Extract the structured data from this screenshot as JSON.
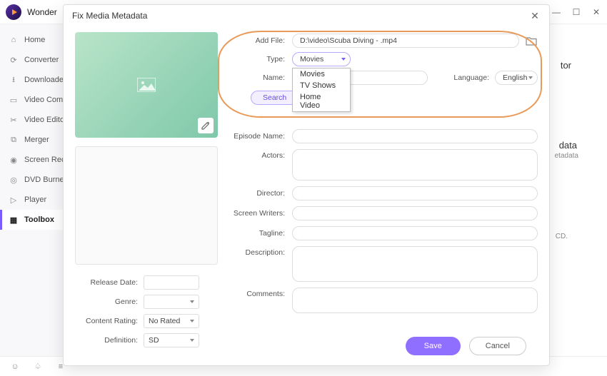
{
  "app": {
    "name": "Wonder"
  },
  "win": {
    "min": "—",
    "max": "☐",
    "close": "✕"
  },
  "sidebar": {
    "items": [
      {
        "icon": "home",
        "label": "Home"
      },
      {
        "icon": "convert",
        "label": "Converter"
      },
      {
        "icon": "download",
        "label": "Downloader"
      },
      {
        "icon": "compress",
        "label": "Video Compressor"
      },
      {
        "icon": "edit",
        "label": "Video Editor"
      },
      {
        "icon": "merge",
        "label": "Merger"
      },
      {
        "icon": "record",
        "label": "Screen Recorder"
      },
      {
        "icon": "dvd",
        "label": "DVD Burner"
      },
      {
        "icon": "player",
        "label": "Player"
      },
      {
        "icon": "toolbox",
        "label": "Toolbox"
      }
    ]
  },
  "bg": {
    "snip1": "tor",
    "snip2": "data",
    "snip3": "etadata",
    "snip4": "CD."
  },
  "modal": {
    "title": "Fix Media Metadata",
    "addfile_label": "Add File:",
    "addfile_value": "D:\\video\\Scuba Diving - .mp4",
    "type_label": "Type:",
    "type_value": "Movies",
    "type_options": [
      "Movies",
      "TV Shows",
      "Home Video"
    ],
    "name_label": "Name:",
    "language_label": "Language:",
    "language_value": "English",
    "search_btn": "Search",
    "left_form": {
      "release_label": "Release Date:",
      "genre_label": "Genre:",
      "rating_label": "Content Rating:",
      "rating_value": "No Rated",
      "definition_label": "Definition:",
      "definition_value": "SD"
    },
    "right_form": {
      "episode_label": "Episode Name:",
      "actors_label": "Actors:",
      "director_label": "Director:",
      "writers_label": "Screen Writers:",
      "tagline_label": "Tagline:",
      "description_label": "Description:",
      "comments_label": "Comments:"
    },
    "save_btn": "Save",
    "cancel_btn": "Cancel"
  }
}
